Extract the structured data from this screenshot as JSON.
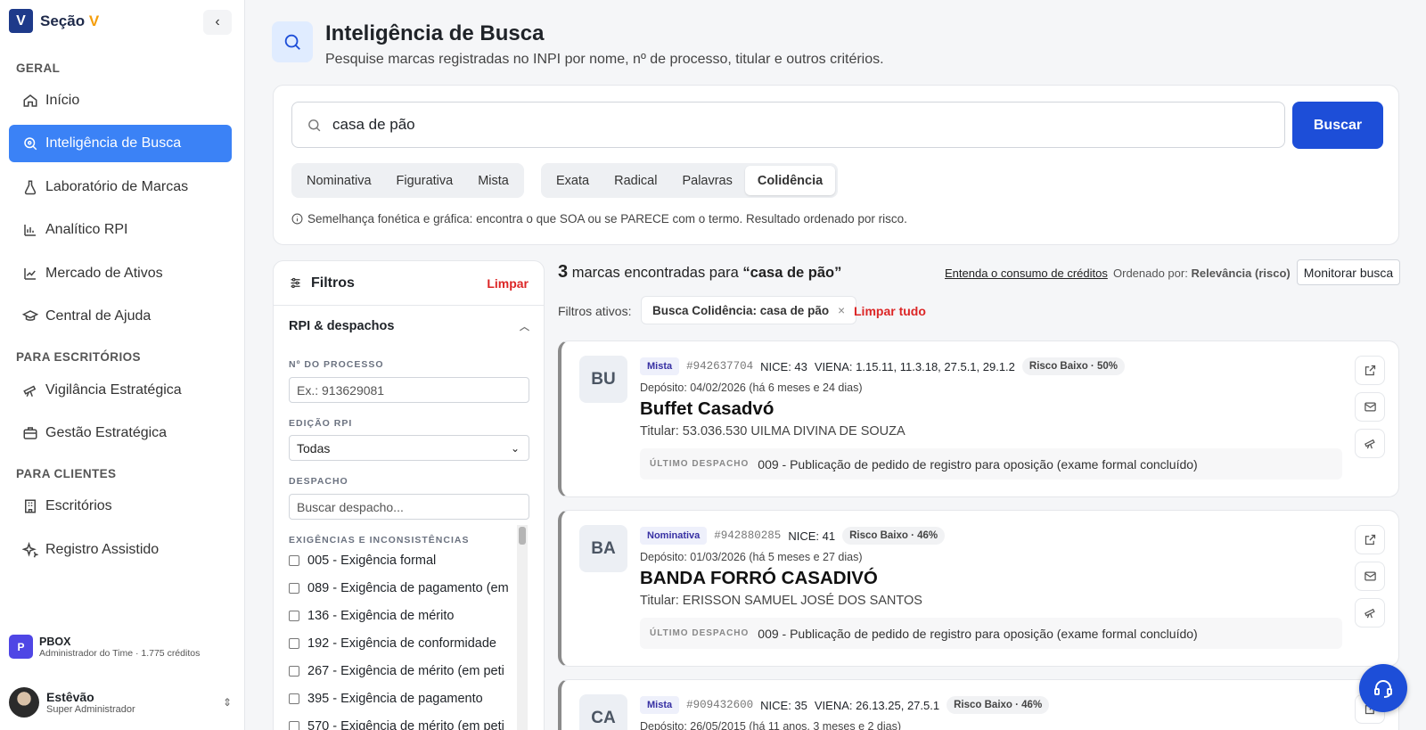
{
  "app": {
    "logo_text": "Seção",
    "logo_accent": "V",
    "logo_mark": "V",
    "collapse_icon": "chevron-left-icon"
  },
  "sidebar": {
    "sections": [
      "GERAL",
      "PARA ESCRITÓRIOS",
      "PARA CLIENTES"
    ],
    "items": [
      {
        "label": "Início",
        "icon": "home-icon"
      },
      {
        "label": "Inteligência de Busca",
        "icon": "search-target-icon",
        "active": true
      },
      {
        "label": "Laboratório de Marcas",
        "icon": "flask-icon"
      },
      {
        "label": "Analítico RPI",
        "icon": "bar-chart-icon"
      },
      {
        "label": "Mercado de Ativos",
        "icon": "line-chart-icon"
      },
      {
        "label": "Central de Ajuda",
        "icon": "graduation-cap-icon"
      },
      {
        "label": "Vigilância Estratégica",
        "icon": "telescope-icon"
      },
      {
        "label": "Gestão Estratégica",
        "icon": "briefcase-icon"
      },
      {
        "label": "Escritórios",
        "icon": "building-icon"
      },
      {
        "label": "Registro Assistido",
        "icon": "sparkles-icon"
      }
    ],
    "team": {
      "badge": "P",
      "name": "PBOX",
      "sub": "Administrador do Time · 1.775 créditos"
    },
    "user": {
      "name": "Estêvão",
      "role": "Super Administrador"
    }
  },
  "header": {
    "title": "Inteligência de Busca",
    "subtitle": "Pesquise marcas registradas no INPI por nome, nº de processo, titular e outros critérios."
  },
  "search": {
    "query": "casa de pão",
    "button": "Buscar",
    "type_tabs": [
      "Nominativa",
      "Figurativa",
      "Mista"
    ],
    "mode_tabs": [
      "Exata",
      "Radical",
      "Palavras",
      "Colidência"
    ],
    "active_mode": "Colidência",
    "hint": "Semelhança fonética e gráfica: encontra o que SOA ou se PARECE com o termo. Resultado ordenado por risco."
  },
  "filters": {
    "title": "Filtros",
    "clear": "Limpar",
    "section": "RPI & despachos",
    "process_label": "Nº DO PROCESSO",
    "process_placeholder": "Ex.: 913629081",
    "edition_label": "EDIÇÃO RPI",
    "edition_value": "Todas",
    "despacho_label": "DESPACHO",
    "despacho_placeholder": "Buscar despacho...",
    "exig_label": "EXIGÊNCIAS E INCONSISTÊNCIAS",
    "exig_items": [
      "005 - Exigência formal",
      "089 - Exigência de pagamento (em",
      "136 - Exigência de mérito",
      "192 - Exigência de conformidade",
      "267 - Exigência de mérito (em peti",
      "395 - Exigência de pagamento",
      "570 - Exigência de mérito (em peti"
    ]
  },
  "results": {
    "count": "3",
    "count_text": "marcas encontradas para",
    "query_quoted": "“casa de pão”",
    "credit_link": "Entenda o consumo de créditos",
    "order_label": "Ordenado por:",
    "order_value": "Relevância (risco)",
    "monitor": "Monitorar busca",
    "active_label": "Filtros ativos:",
    "chip": "Busca Colidência: casa de pão",
    "chip_x": "×",
    "clear_all": "Limpar tudo",
    "desp_label": "ÚLTIMO DESPACHO",
    "items": [
      {
        "initials": "BU",
        "type": "Mista",
        "number": "#942637704",
        "nice": "NICE: 43",
        "viena": "VIENA: 1.15.11, 11.3.18, 27.5.1, 29.1.2",
        "risk": "Risco Baixo · 50%",
        "deposit": "Depósito: 04/02/2026",
        "age": "(há 6 meses e 24 dias)",
        "name": "Buffet Casadvó",
        "holder": "Titular: 53.036.530 UILMA DIVINA DE SOUZA",
        "despacho": "009 - Publicação de pedido de registro para oposição (exame formal concluído)"
      },
      {
        "initials": "BA",
        "type": "Nominativa",
        "number": "#942880285",
        "nice": "NICE: 41",
        "viena": "",
        "risk": "Risco Baixo · 46%",
        "deposit": "Depósito: 01/03/2026",
        "age": "(há 5 meses e 27 dias)",
        "name": "BANDA FORRÓ CASADIVÓ",
        "holder": "Titular: ERISSON SAMUEL JOSÉ DOS SANTOS",
        "despacho": "009 - Publicação de pedido de registro para oposição (exame formal concluído)"
      },
      {
        "initials": "CA",
        "type": "Mista",
        "number": "#909432600",
        "nice": "NICE: 35",
        "viena": "VIENA: 26.13.25, 27.5.1",
        "risk": "Risco Baixo · 46%",
        "deposit": "Depósito: 26/05/2015",
        "age": "(há 11 anos, 3 meses e 2 dias)",
        "name": "",
        "holder": "",
        "despacho": ""
      }
    ]
  },
  "help_icon": "headset-icon"
}
